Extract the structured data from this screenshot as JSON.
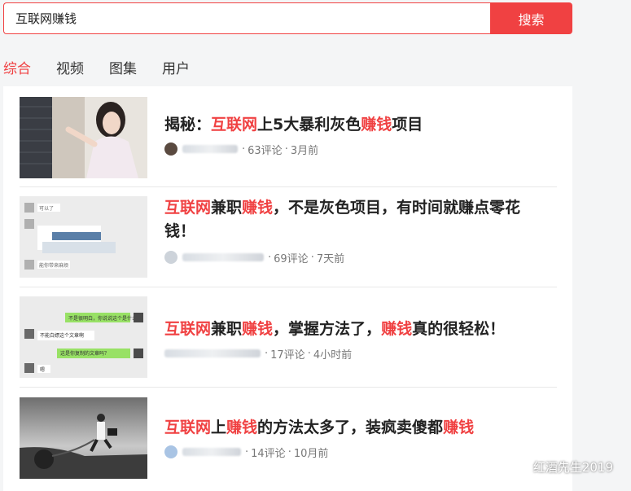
{
  "search": {
    "query": "互联网赚钱",
    "button": "搜索"
  },
  "tabs": [
    "综合",
    "视频",
    "图集",
    "用户"
  ],
  "results": [
    {
      "title_parts": [
        "揭秘：",
        "互联网",
        "上5大暴利灰色",
        "赚钱",
        "项目"
      ],
      "comments": "63评论",
      "time": "3月前"
    },
    {
      "title_parts": [
        "",
        "互联网",
        "兼职",
        "赚钱",
        "，不是灰色项目，有时间就赚点零花钱！"
      ],
      "comments": "69评论",
      "time": "7天前"
    },
    {
      "title_parts": [
        "",
        "互联网",
        "兼职",
        "赚钱",
        "，掌握方法了，",
        "赚钱",
        "真的很轻松！"
      ],
      "comments": "17评论",
      "time": "4小时前"
    },
    {
      "title_parts": [
        "",
        "互联网",
        "上",
        "赚钱",
        "的方法太多了，装疯卖傻都",
        "赚钱",
        ""
      ],
      "comments": "14评论",
      "time": "10月前"
    }
  ],
  "chat_bubbles_2": [
    "可以了",
    "能你带来麻烦"
  ],
  "chat_bubbles_3": [
    "不是很明白，你说说这个是什么",
    "不能白嫖这个文章啊",
    "这是你复制的文章吗？",
    "嗯"
  ],
  "watermark": "红酒先生2019",
  "colors": {
    "accent": "#f04142"
  }
}
